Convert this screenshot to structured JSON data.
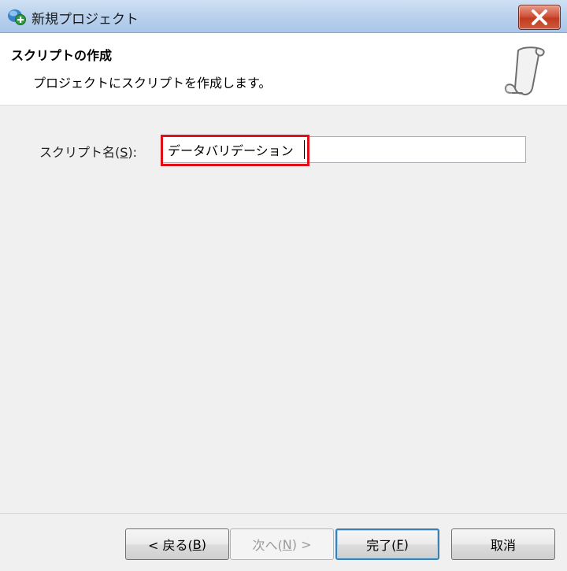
{
  "window": {
    "title": "新規プロジェクト"
  },
  "header": {
    "title": "スクリプトの作成",
    "subtitle": "プロジェクトにスクリプトを作成します。"
  },
  "form": {
    "script_name_label": "スクリプト名(S):",
    "script_name_label_text": "スクリプト名(",
    "script_name_label_key": "S",
    "script_name_label_end": "):",
    "script_name_value": "データバリデーション"
  },
  "buttons": {
    "back": "< 戻る(B)",
    "next": "次へ(N) >",
    "finish": "完了(F)",
    "cancel": "取消"
  },
  "icons": {
    "app": "project-add-icon",
    "close": "close-icon",
    "header": "scroll-icon"
  },
  "colors": {
    "highlight": "#e0101a",
    "close_button": "#c23b21",
    "titlebar": "#bcd3ee"
  }
}
